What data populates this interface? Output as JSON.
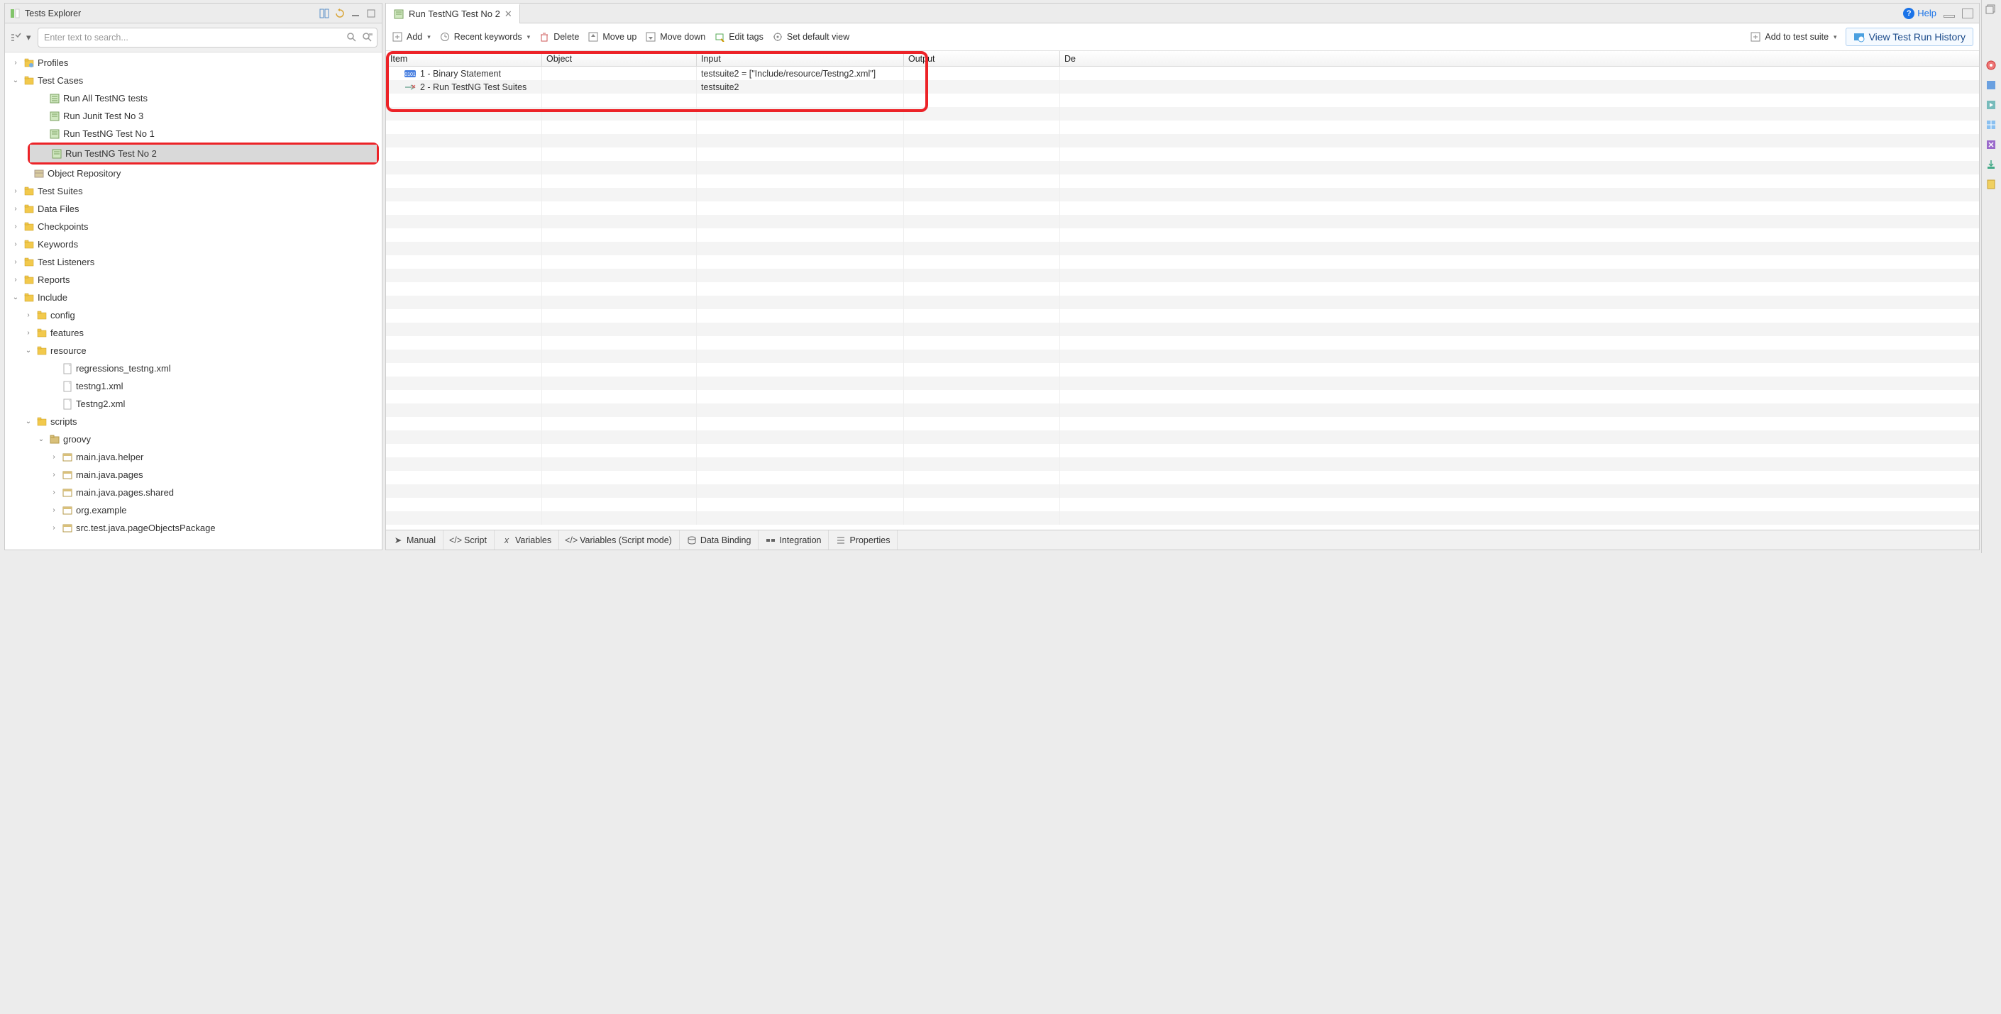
{
  "explorer": {
    "title": "Tests Explorer",
    "search_placeholder": "Enter text to search...",
    "tree": {
      "profiles": "Profiles",
      "test_cases": "Test Cases",
      "run_all": "Run All TestNG tests",
      "run_junit3": "Run Junit Test No 3",
      "run_tng1": "Run TestNG Test No 1",
      "run_tng2": "Run TestNG Test No 2",
      "object_repo": "Object Repository",
      "test_suites": "Test Suites",
      "data_files": "Data Files",
      "checkpoints": "Checkpoints",
      "keywords": "Keywords",
      "test_listeners": "Test Listeners",
      "reports": "Reports",
      "include": "Include",
      "config": "config",
      "features": "features",
      "resource": "resource",
      "res_f1": "regressions_testng.xml",
      "res_f2": "testng1.xml",
      "res_f3": "Testng2.xml",
      "scripts": "scripts",
      "groovy": "groovy",
      "g1": "main.java.helper",
      "g2": "main.java.pages",
      "g3": "main.java.pages.shared",
      "g4": "org.example",
      "g5": "src.test.java.pageObjectsPackage"
    }
  },
  "editor": {
    "tab_title": "Run TestNG Test No 2",
    "help": "Help",
    "toolbar": {
      "add": "Add",
      "recent": "Recent keywords",
      "delete": "Delete",
      "moveup": "Move up",
      "movedown": "Move down",
      "edittags": "Edit tags",
      "setdefault": "Set default view",
      "addsuite": "Add to test suite",
      "viewhist": "View Test Run History"
    },
    "columns": {
      "item": "Item",
      "object": "Object",
      "input": "Input",
      "output": "Output",
      "de": "De"
    },
    "rows": [
      {
        "item": "1 - Binary Statement",
        "object": "",
        "input": "testsuite2 = [\"Include/resource/Testng2.xml\"]",
        "output": ""
      },
      {
        "item": "2 - Run TestNG Test Suites",
        "object": "",
        "input": "testsuite2",
        "output": ""
      }
    ],
    "bottom": {
      "manual": "Manual",
      "script": "Script",
      "variables": "Variables",
      "varscript": "Variables (Script mode)",
      "databind": "Data Binding",
      "integration": "Integration",
      "properties": "Properties"
    }
  }
}
